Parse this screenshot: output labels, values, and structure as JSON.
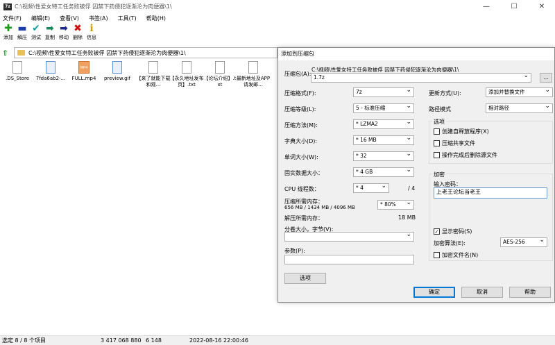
{
  "window": {
    "app_icon": "7z",
    "title": "C:\\视频\\性爱女特工任务败被俘 囚禁下药侵犯逐渐沦为肉便器\\1\\",
    "minimize": "—",
    "maximize": "☐",
    "close": "✕"
  },
  "menu": [
    "文件(F)",
    "编辑(E)",
    "查看(V)",
    "书签(A)",
    "工具(T)",
    "帮助(H)"
  ],
  "toolbar": [
    {
      "label": "添加",
      "icon": "plus-icon",
      "glyph": "✚",
      "color": "#1a9a1a"
    },
    {
      "label": "解压",
      "icon": "minus-icon",
      "glyph": "▬",
      "color": "#1a3ab0"
    },
    {
      "label": "测试",
      "icon": "check-icon",
      "glyph": "✔",
      "color": "#1aa0a0"
    },
    {
      "label": "复制",
      "icon": "copy-arrow-icon",
      "glyph": "➡",
      "color": "#1a8a5a"
    },
    {
      "label": "移动",
      "icon": "move-arrow-icon",
      "glyph": "➡",
      "color": "#1a2a8a"
    },
    {
      "label": "删除",
      "icon": "delete-icon",
      "glyph": "✖",
      "color": "#d01010"
    },
    {
      "label": "信息",
      "icon": "info-icon",
      "glyph": "ℹ",
      "color": "#c8a000"
    }
  ],
  "address": {
    "up": "⇧",
    "path": "C:\\视频\\性爱女特工任务败被俘 囚禁下药侵犯逐渐沦为肉便器\\1\\"
  },
  "files": [
    {
      "name": ".DS_Store",
      "type": "doc"
    },
    {
      "name": "7fda6ab2-...",
      "type": "img"
    },
    {
      "name": "FULL.mp4",
      "type": "mp4",
      "badge": "MP4"
    },
    {
      "name": "preview.gif",
      "type": "img"
    },
    {
      "name": "【来了就能下载和观...",
      "type": "doc"
    },
    {
      "name": "【永久地址发布页】.txt",
      "type": "doc"
    },
    {
      "name": "【论坛介绍】.txt",
      "type": "doc"
    },
    {
      "name": "最新地址及APP请发邮...",
      "type": "doc"
    }
  ],
  "status": {
    "selected": "选定 8 / 8 个项目",
    "size": "3 417 068 880",
    "packed": "6 148",
    "date": "2022-08-16 22:00:46"
  },
  "dialog": {
    "title": "添加到压缩包",
    "archive_label": "压缩包(A):",
    "archive_path": "C:\\视频\\性爱女特工任务败被俘 囚禁下药侵犯逐渐沦为肉便器\\1\\",
    "archive_name": "1.7z",
    "browse": "...",
    "format_label": "压缩格式(F):",
    "format": "7z",
    "level_label": "压缩等级(L):",
    "level": "5 - 标准压缩",
    "method_label": "压缩方法(M):",
    "method": "* LZMA2",
    "dict_label": "字典大小(D):",
    "dict": "* 16 MB",
    "word_label": "单词大小(W):",
    "word": "* 32",
    "solid_label": "固实数据大小：",
    "solid": "* 4 GB",
    "cpu_label": "CPU 线程数：",
    "cpu": "* 4",
    "cpu_max": "/ 4",
    "mem_comp_label": "压缩所需内存：",
    "mem_comp_detail": "656 MB / 1434 MB / 4096 MB",
    "mem_pct": "* 80%",
    "mem_decomp_label": "解压所需内存：",
    "mem_decomp": "18 MB",
    "split_label": "分卷大小，字节(V):",
    "split": "",
    "params_label": "参数(P):",
    "params": "",
    "options_button": "选项",
    "update_label": "更新方式(U):",
    "update": "添加并替换文件",
    "pathmode_label": "路径模式",
    "pathmode": "相对路径",
    "options_group": "选项",
    "opt_sfx": "创建自释放程序(X)",
    "opt_shared": "压缩共享文件",
    "opt_delete": "操作完成后删除源文件",
    "enc_group": "加密",
    "enc_password_label": "输入密码：",
    "enc_password": "上老王论坛当老王",
    "show_password": "显示密码(S)",
    "show_password_check": "✓",
    "enc_method_label": "加密算法(E):",
    "enc_method": "AES-256",
    "enc_names": "加密文件名(N)",
    "ok": "确定",
    "cancel": "取消",
    "help": "帮助"
  }
}
